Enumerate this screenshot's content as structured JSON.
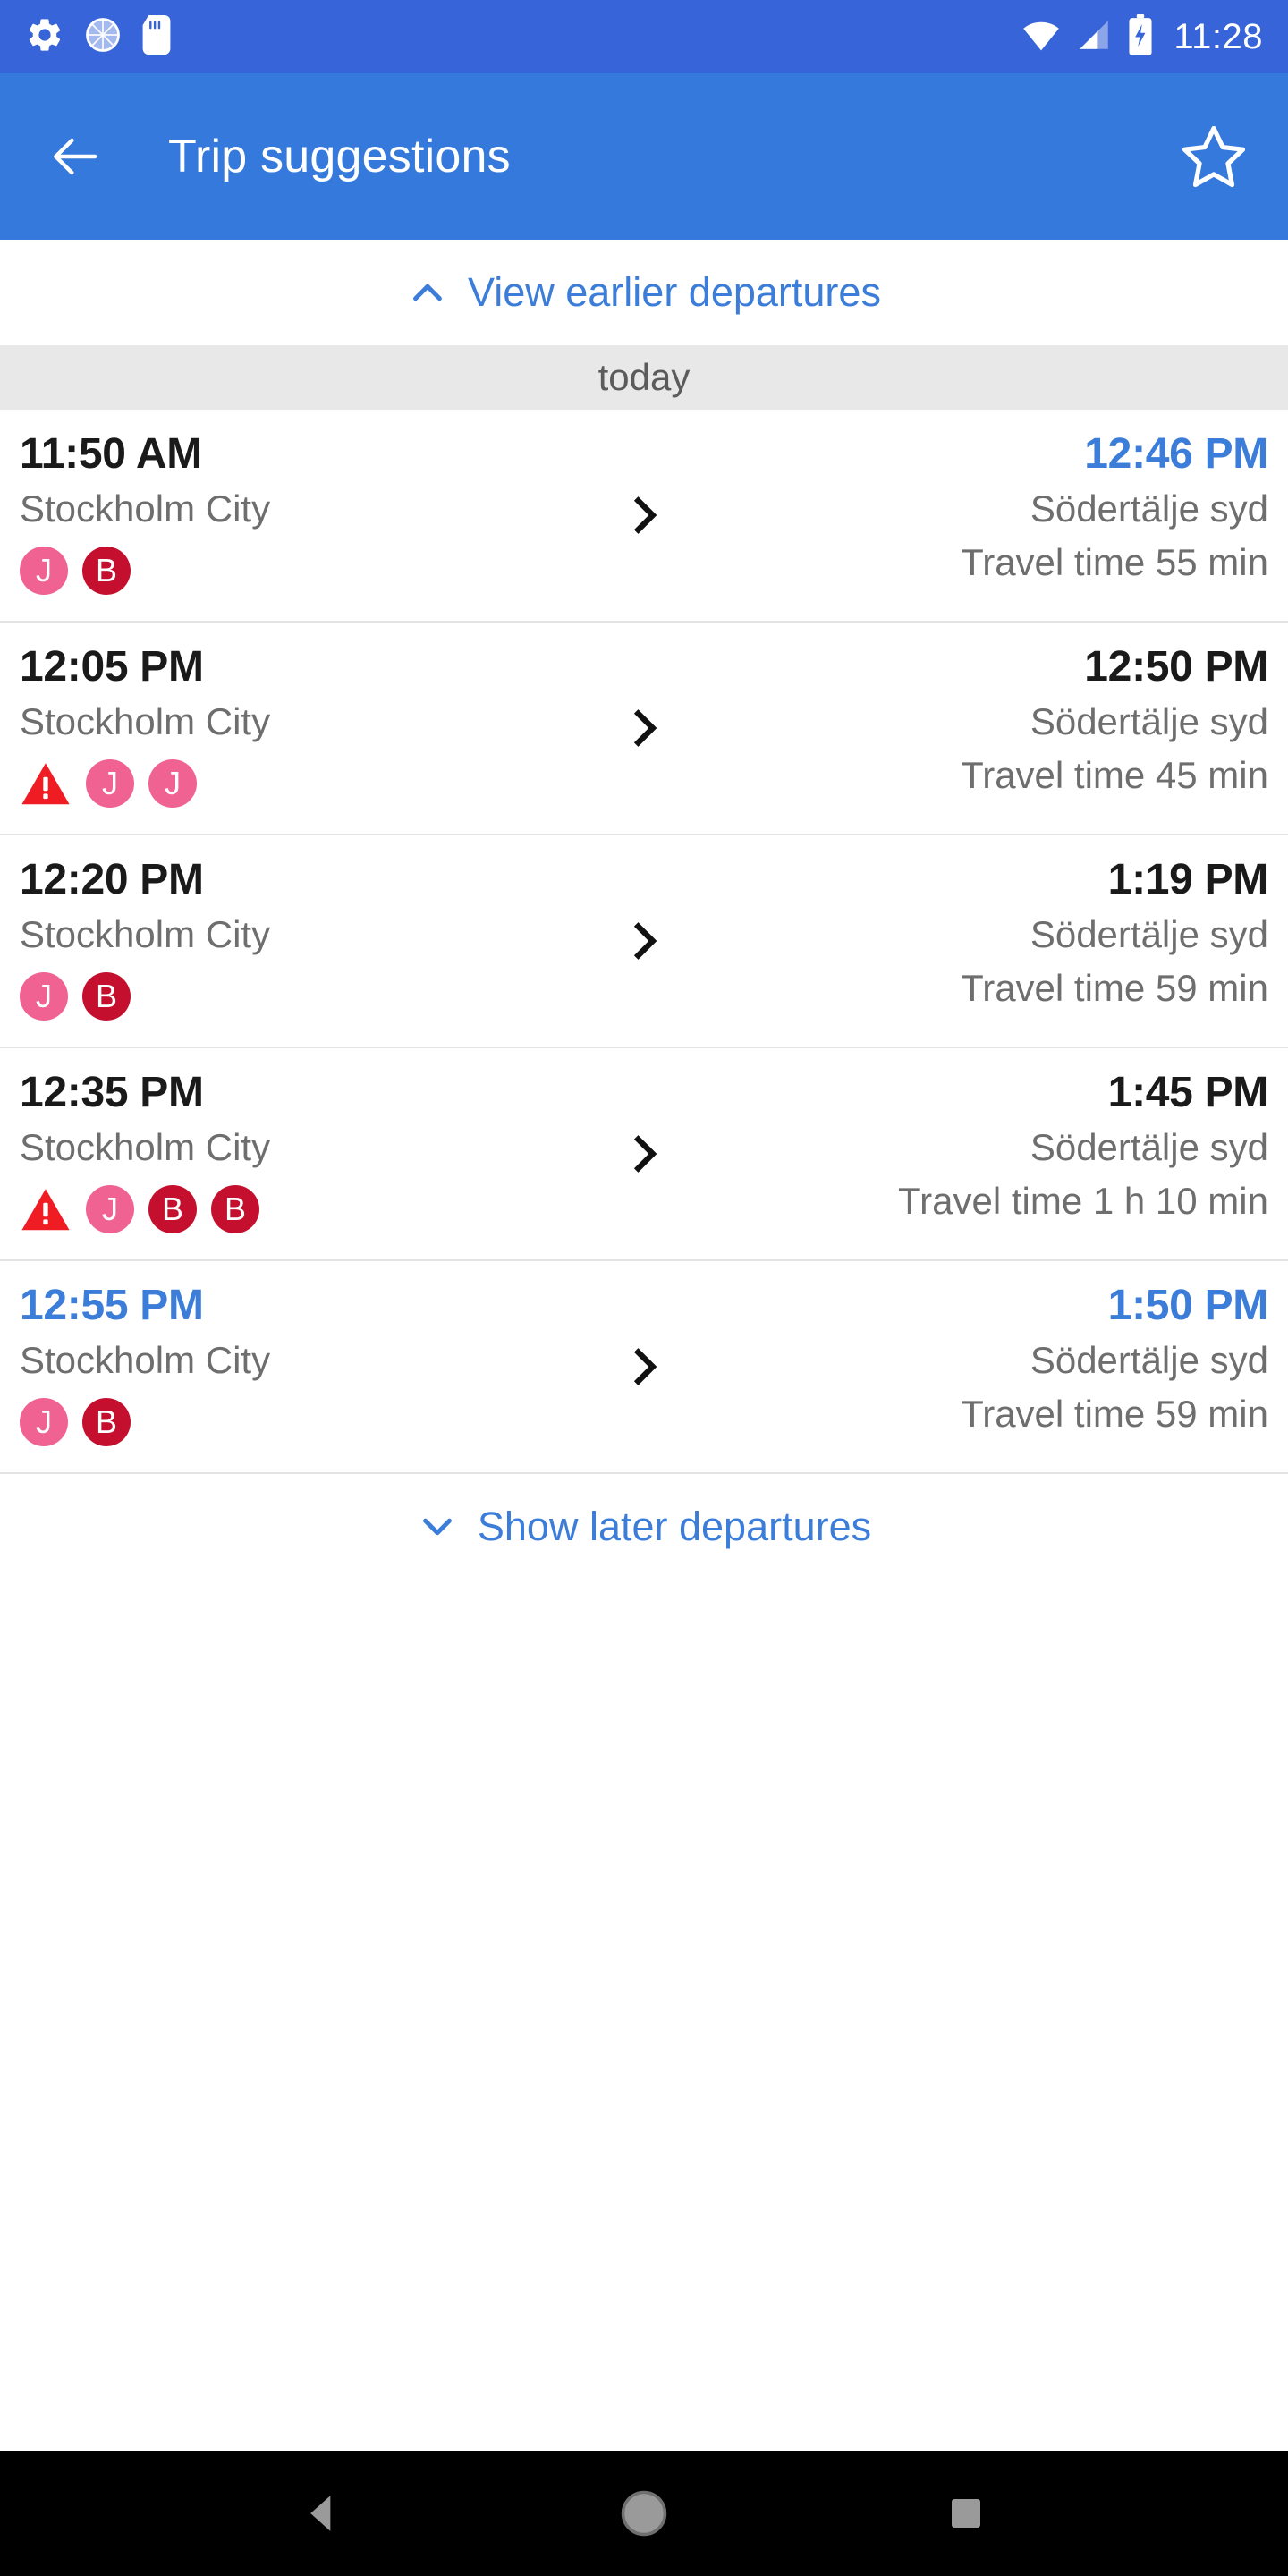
{
  "status_bar": {
    "time": "11:28",
    "left_icons": [
      "gear-icon",
      "sync-circle-icon",
      "sd-card-icon"
    ],
    "right_icons": [
      "wifi-icon",
      "cellular-signal-icon",
      "battery-charging-icon"
    ],
    "background_color": "#3764d8"
  },
  "app_bar": {
    "back_label": "back-arrow-icon",
    "title": "Trip suggestions",
    "favorite_label": "star-outline-icon",
    "background_color": "#3479db"
  },
  "earlier_link": {
    "label": "View earlier departures",
    "icon": "chevron-up-icon",
    "color": "#3b7dd8"
  },
  "later_link": {
    "label": "Show later departures",
    "icon": "chevron-down-icon",
    "color": "#3b7dd8"
  },
  "day_header": {
    "label": "today"
  },
  "colors": {
    "accent_blue": "#3b7dd8",
    "badge_pink": "#f06292",
    "badge_crimson": "#c4102e",
    "warning_red": "#ef1c24",
    "muted_text": "#6e6e6e"
  },
  "trips": [
    {
      "departure_time": "11:50 AM",
      "departure_highlight": false,
      "origin": "Stockholm City",
      "arrival_time": "12:46 PM",
      "arrival_highlight": true,
      "destination": "Södertälje syd",
      "travel_time": "Travel time 55 min",
      "badges": [
        {
          "type": "line",
          "label": "J",
          "color": "pink"
        },
        {
          "type": "line",
          "label": "B",
          "color": "crimson"
        }
      ]
    },
    {
      "departure_time": "12:05 PM",
      "departure_highlight": false,
      "origin": "Stockholm City",
      "arrival_time": "12:50 PM",
      "arrival_highlight": false,
      "destination": "Södertälje syd",
      "travel_time": "Travel time 45 min",
      "badges": [
        {
          "type": "warning",
          "label": "!",
          "color": "red"
        },
        {
          "type": "line",
          "label": "J",
          "color": "pink"
        },
        {
          "type": "line",
          "label": "J",
          "color": "pink"
        }
      ]
    },
    {
      "departure_time": "12:20 PM",
      "departure_highlight": false,
      "origin": "Stockholm City",
      "arrival_time": "1:19 PM",
      "arrival_highlight": false,
      "destination": "Södertälje syd",
      "travel_time": "Travel time 59 min",
      "badges": [
        {
          "type": "line",
          "label": "J",
          "color": "pink"
        },
        {
          "type": "line",
          "label": "B",
          "color": "crimson"
        }
      ]
    },
    {
      "departure_time": "12:35 PM",
      "departure_highlight": false,
      "origin": "Stockholm City",
      "arrival_time": "1:45 PM",
      "arrival_highlight": false,
      "destination": "Södertälje syd",
      "travel_time": "Travel time 1 h 10 min",
      "badges": [
        {
          "type": "warning",
          "label": "!",
          "color": "red"
        },
        {
          "type": "line",
          "label": "J",
          "color": "pink"
        },
        {
          "type": "line",
          "label": "B",
          "color": "crimson"
        },
        {
          "type": "line",
          "label": "B",
          "color": "crimson"
        }
      ]
    },
    {
      "departure_time": "12:55 PM",
      "departure_highlight": true,
      "origin": "Stockholm City",
      "arrival_time": "1:50 PM",
      "arrival_highlight": true,
      "destination": "Södertälje syd",
      "travel_time": "Travel time 59 min",
      "badges": [
        {
          "type": "line",
          "label": "J",
          "color": "pink"
        },
        {
          "type": "line",
          "label": "B",
          "color": "crimson"
        }
      ]
    }
  ],
  "nav_bar": {
    "back": "nav-back-icon",
    "home": "nav-home-icon",
    "recents": "nav-recents-icon"
  }
}
